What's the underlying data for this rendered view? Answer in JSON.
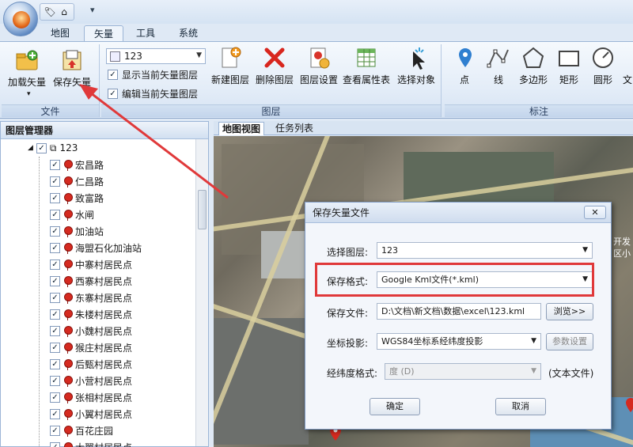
{
  "quick_access": {
    "icons": [
      "tag-icon",
      "home-icon"
    ],
    "more": "▾"
  },
  "tabs": [
    {
      "label": "地图"
    },
    {
      "label": "矢量"
    },
    {
      "label": "工具"
    },
    {
      "label": "系统"
    }
  ],
  "ribbon": {
    "file_group": {
      "label": "文件",
      "load": "加载矢量",
      "save": "保存矢量"
    },
    "layer_select": {
      "value": "123"
    },
    "show_current": "显示当前矢量图层",
    "edit_current": "编辑当前矢量图层",
    "layer_group": {
      "label": "图层",
      "buttons": [
        "新建图层",
        "删除图层",
        "图层设置",
        "查看属性表",
        "选择对象"
      ]
    },
    "annotate_group": {
      "label": "标注",
      "buttons": [
        "点",
        "线",
        "多边形",
        "矩形",
        "圆形",
        "文"
      ]
    }
  },
  "layer_manager": {
    "title": "图层管理器",
    "root": "123",
    "items": [
      "宏昌路",
      "仁昌路",
      "致富路",
      "水闸",
      "加油站",
      "海盟石化加油站",
      "中寨村居民点",
      "西寨村居民点",
      "东寨村居民点",
      "朱楼村居民点",
      "小魏村居民点",
      "猴庄村居民点",
      "后甄村居民点",
      "小营村居民点",
      "张相村居民点",
      "小翼村居民点",
      "百花庄园",
      "大翼村居民点"
    ]
  },
  "map_tabs": {
    "map_view": "地图视图",
    "task_list": "任务列表"
  },
  "dialog": {
    "title": "保存矢量文件",
    "close": "✕",
    "layer_label": "选择图层:",
    "layer_value": "123",
    "format_label": "保存格式:",
    "format_value": "Google Kml文件(*.kml)",
    "file_label": "保存文件:",
    "file_value": "D:\\文档\\新文档\\数据\\excel\\123.kml",
    "browse": "浏览>>",
    "proj_label": "坐标投影:",
    "proj_value": "WGS84坐标系经纬度投影",
    "param": "参数设置",
    "latlon_label": "经纬度格式:",
    "latlon_value": "度 (D)",
    "text_file": "(文本文件)",
    "ok": "确定",
    "cancel": "取消"
  },
  "map_text": {
    "side1": "开发",
    "side2": "区小"
  },
  "colors": {
    "accent": "#e0393a",
    "ribbon": "#dfe9f5"
  }
}
